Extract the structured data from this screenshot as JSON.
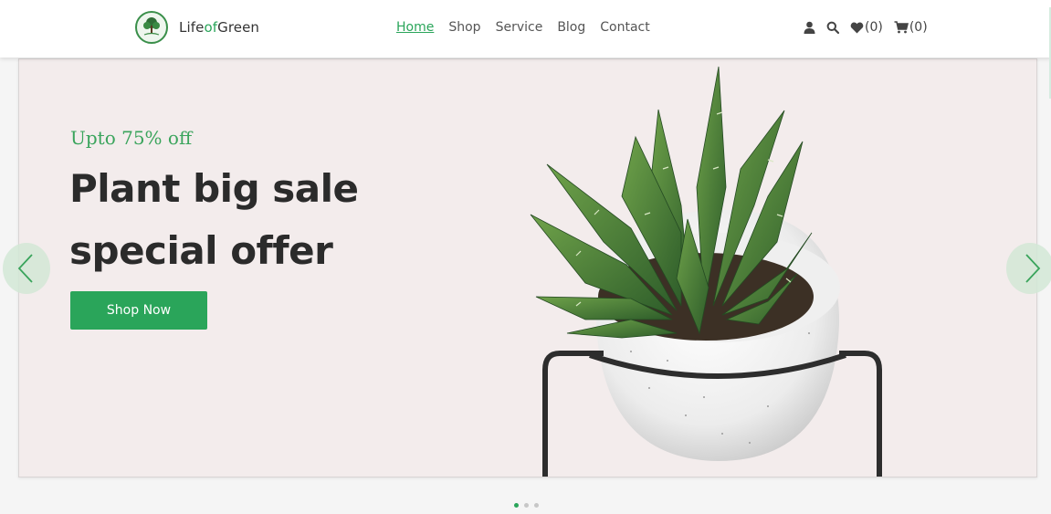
{
  "brand": {
    "prefix": "Life",
    "accent": "of",
    "suffix": "Green"
  },
  "nav": [
    {
      "label": "Home",
      "active": true
    },
    {
      "label": "Shop"
    },
    {
      "label": "Service"
    },
    {
      "label": "Blog"
    },
    {
      "label": "Contact"
    }
  ],
  "header_icons": {
    "user": "user-icon",
    "search": "search-icon",
    "wishlist": {
      "icon": "heart-icon",
      "count": "(0)"
    },
    "cart": {
      "icon": "cart-icon",
      "count": "(0)"
    }
  },
  "hero": {
    "subtitle": "Upto 75% off",
    "title_line1": "Plant big sale",
    "title_line2": "special offer",
    "button_label": "Shop Now"
  },
  "carousel": {
    "slides": 3,
    "active": 1
  },
  "colors": {
    "accent": "#2aa55a",
    "hero_bg": "#f3ecec",
    "title": "#2b2b2b"
  }
}
